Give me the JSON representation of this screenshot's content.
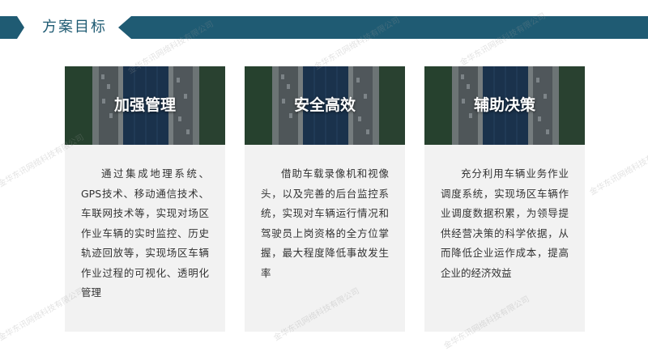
{
  "header": {
    "title": "方案目标",
    "bar_color": "#1f5b73"
  },
  "cards": [
    {
      "title": "加强管理",
      "text": "通过集成地理系统、GPS技术、移动通信技术、车联网技术等，实现对场区作业车辆的实时监控、历史轨迹回放等，实现场区车辆作业过程的可视化、透明化管理"
    },
    {
      "title": "安全高效",
      "text": "借助车载录像机和视像头，以及完善的后台监控系统，实现对车辆运行情况和驾驶员上岗资格的全方位掌握，最大程度降低事故发生率"
    },
    {
      "title": "辅助决策",
      "text": "充分利用车辆业务作业调度系统，实现场区车辆作业调度数据积累，为领导提供经营决策的科学依据，从而降低企业运作成本，提高企业的经济效益"
    }
  ],
  "watermark": "金华东讯网络科技有限公司"
}
